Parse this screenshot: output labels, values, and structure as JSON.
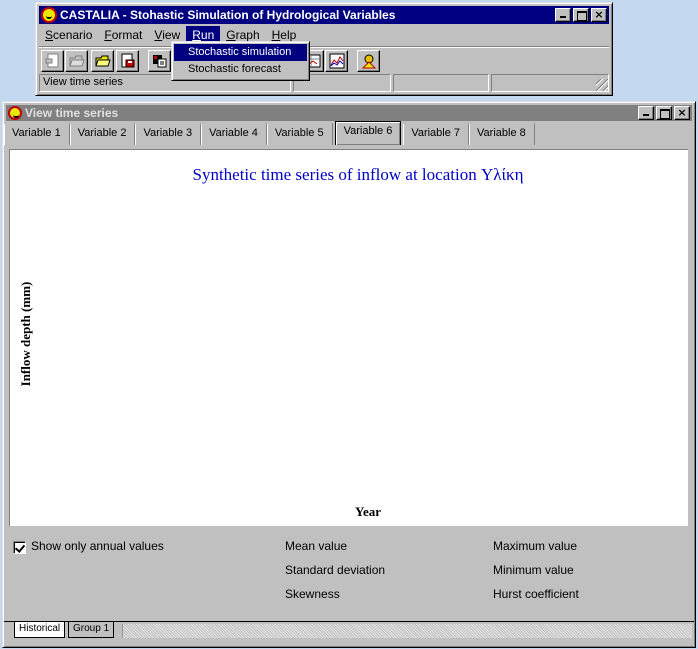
{
  "app_window": {
    "title": "CASTALIA - Stohastic Simulation of Hydrological Variables",
    "menu": [
      {
        "label": "Scenario",
        "underline": "S",
        "rest": "cenario"
      },
      {
        "label": "Format",
        "underline": "F",
        "rest": "ormat"
      },
      {
        "label": "View",
        "underline": "V",
        "rest": "iew"
      },
      {
        "label": "Run",
        "underline": "R",
        "rest": "un"
      },
      {
        "label": "Graph",
        "underline": "G",
        "rest": "raph"
      },
      {
        "label": "Help",
        "underline": "H",
        "rest": "elp"
      }
    ],
    "toolbar_icons": [
      "new-scenario-icon",
      "open-folder-icon",
      "open-file-icon",
      "save-icon",
      "data-icon",
      "table-icon",
      "chart-icon",
      "user-help-icon"
    ],
    "status": {
      "left": "View time series",
      "mid": "",
      "right": ""
    }
  },
  "run_menu": {
    "items": [
      {
        "label": "Stochastic simulation",
        "selected": true
      },
      {
        "label": "Stochastic forecast",
        "selected": false
      }
    ]
  },
  "child_window": {
    "title": "View time series",
    "tabs": [
      "Variable 1",
      "Variable 2",
      "Variable 3",
      "Variable 4",
      "Variable 5",
      "Variable 6",
      "Variable 7",
      "Variable 8"
    ],
    "selected_tab": "Variable 6",
    "options": {
      "show_only_annual_label": "Show only annual values",
      "show_only_annual_checked": true
    },
    "stats_labels": {
      "mean": "Mean value",
      "std": "Standard deviation",
      "skew": "Skewness",
      "max": "Maximum value",
      "min": "Minimum value",
      "hurst": "Hurst coefficient"
    },
    "bottom_tabs": [
      "Historical",
      "Group 1"
    ],
    "selected_bottom_tab": "Historical"
  },
  "colors": {
    "desktop": "#c4d8f0",
    "active_title": "#000080",
    "inactive_title": "#808080",
    "chart_title": "#0000c8"
  },
  "chart_data": {
    "type": "line",
    "title": "Synthetic time series of inflow at location Υλίκη",
    "xlabel": "Year",
    "ylabel": "Inflow depth (mm)",
    "series": []
  }
}
